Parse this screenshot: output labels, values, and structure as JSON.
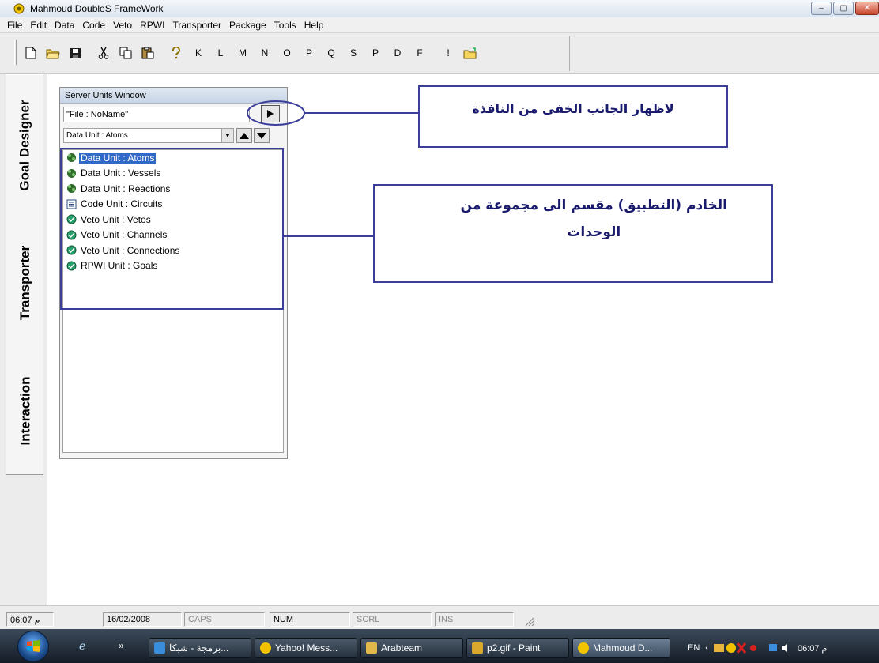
{
  "window": {
    "title": "Mahmoud DoubleS FrameWork",
    "controls": {
      "minimize": "–",
      "maximize": "▢",
      "close": "✕"
    }
  },
  "menu": [
    "File",
    "Edit",
    "Data",
    "Code",
    "Veto",
    "RPWI",
    "Transporter",
    "Package",
    "Tools",
    "Help"
  ],
  "toolbar": {
    "icons": [
      "new-file-icon",
      "open-folder-icon",
      "save-icon",
      "cut-icon",
      "copy-icon",
      "paste-icon",
      "help-icon"
    ],
    "letters": [
      "K",
      "L",
      "M",
      "N",
      "O",
      "P",
      "Q",
      "S",
      "P",
      "D",
      "F",
      "!"
    ],
    "last_icon": "open-folder-arrow-icon"
  },
  "side_tabs": [
    "Goal Designer",
    "Transporter",
    "Interaction"
  ],
  "server_units": {
    "title": "Server Units Window",
    "file_label": "\"File : NoName\"",
    "unit_selector": "Data Unit : Atoms",
    "items": [
      {
        "label": "Data Unit : Atoms",
        "icon": "data-unit-icon",
        "selected": true
      },
      {
        "label": "Data Unit : Vessels",
        "icon": "data-unit-icon",
        "selected": false
      },
      {
        "label": "Data Unit : Reactions",
        "icon": "data-unit-icon",
        "selected": false
      },
      {
        "label": "Code Unit : Circuits",
        "icon": "code-unit-icon",
        "selected": false
      },
      {
        "label": "Veto Unit : Vetos",
        "icon": "veto-unit-icon",
        "selected": false
      },
      {
        "label": "Veto Unit : Channels",
        "icon": "veto-unit-icon",
        "selected": false
      },
      {
        "label": "Veto Unit : Connections",
        "icon": "veto-unit-icon",
        "selected": false
      },
      {
        "label": "RPWI Unit : Goals",
        "icon": "veto-unit-icon",
        "selected": false
      }
    ]
  },
  "annotations": {
    "callout1": "لاظهار الجانب الخفى من النافذة",
    "callout2_line1": "الخادم (التطبيق) مقسم الى مجموعة من",
    "callout2_line2": "الوحدات",
    "color": "#3b3f9a"
  },
  "statusbar": {
    "time": "06:07 م",
    "date": "16/02/2008",
    "caps": "CAPS",
    "num": "NUM",
    "scrl": "SCRL",
    "ins": "INS"
  },
  "taskbar": {
    "apps": [
      {
        "label": "برمجة - شبكا...",
        "icon": "ie-icon",
        "active": false
      },
      {
        "label": "Yahoo! Mess...",
        "icon": "yahoo-icon",
        "active": false
      },
      {
        "label": "Arabteam",
        "icon": "folder-icon",
        "active": false
      },
      {
        "label": "p2.gif - Paint",
        "icon": "paint-icon",
        "active": false
      },
      {
        "label": "Mahmoud D...",
        "icon": "app-icon",
        "active": true
      }
    ],
    "tray": {
      "lang": "EN",
      "clock": "06:07 م"
    }
  }
}
